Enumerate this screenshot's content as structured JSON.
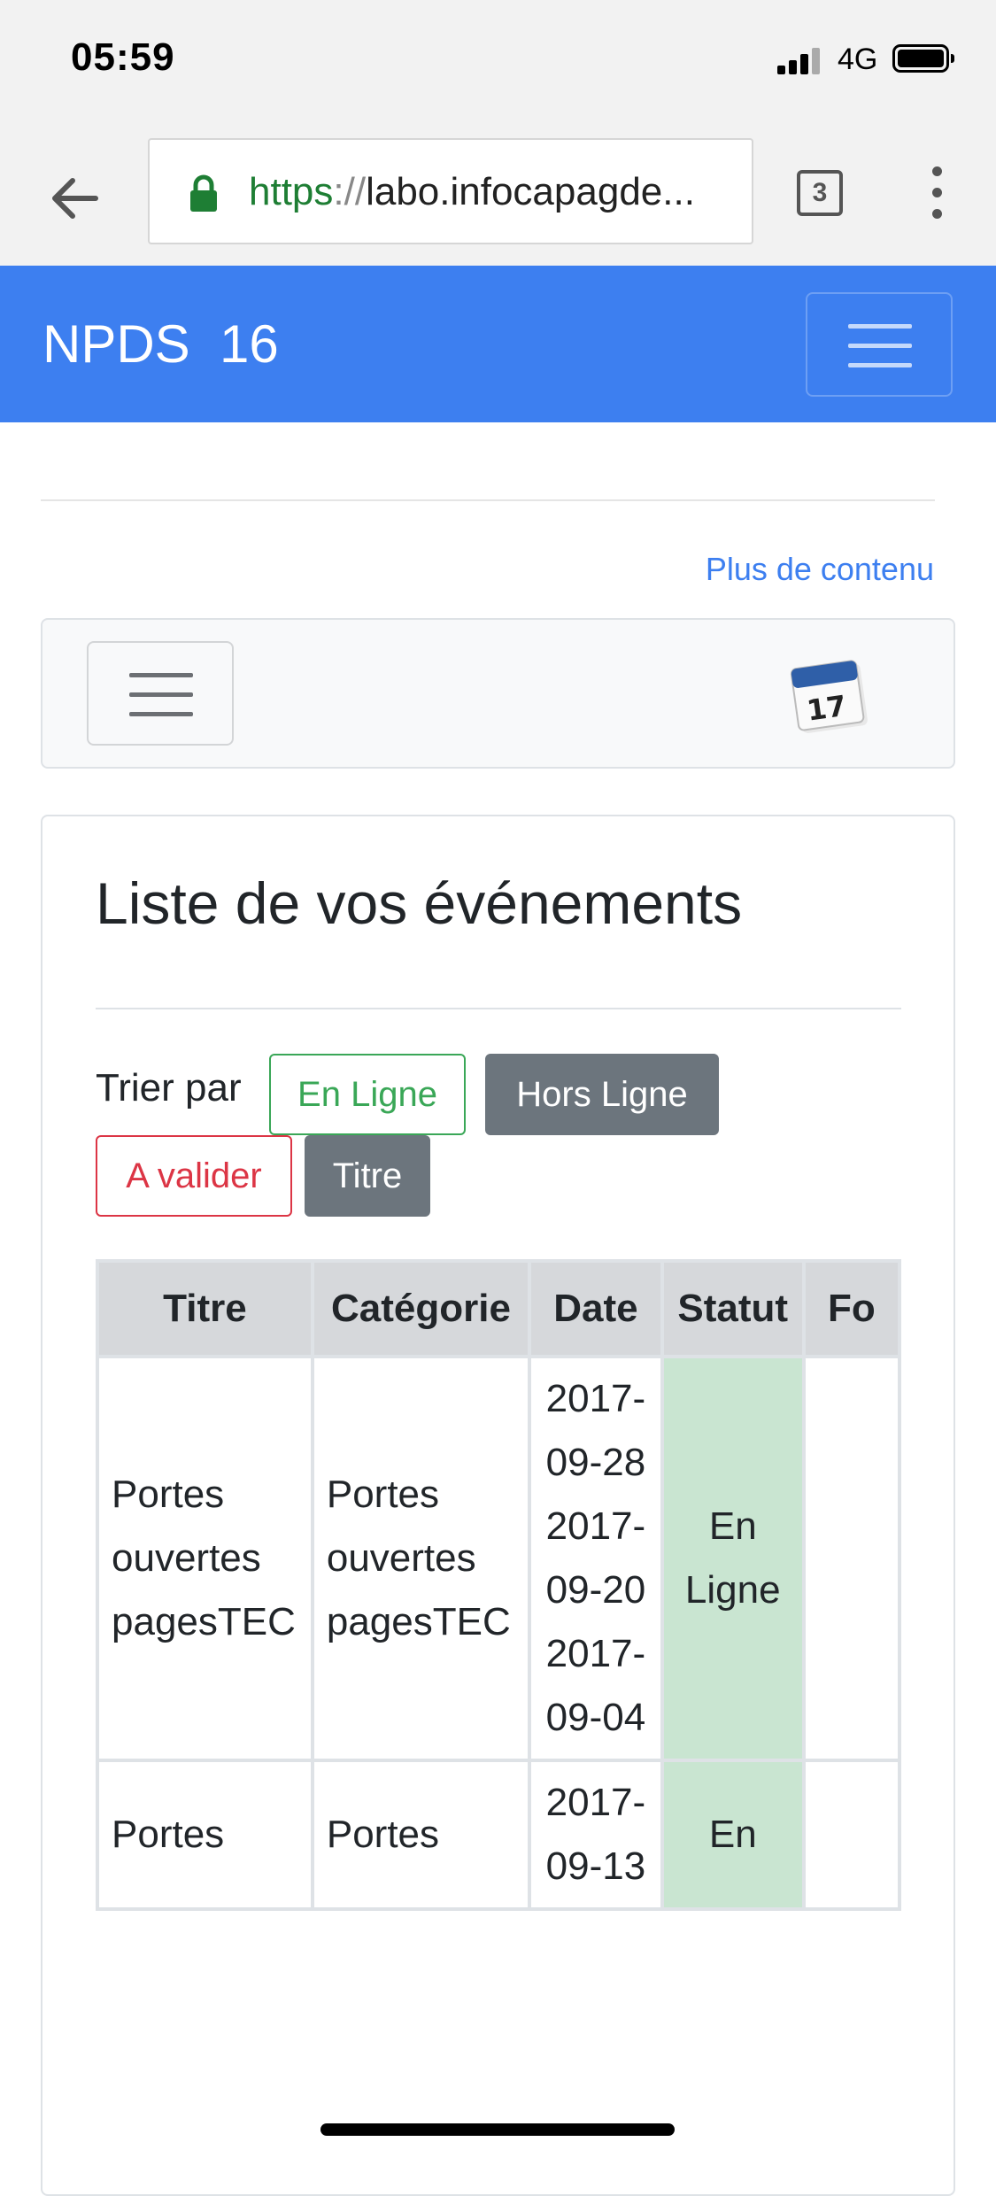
{
  "status_bar": {
    "time": "05:59",
    "network": "4G"
  },
  "browser": {
    "url_scheme": "https",
    "url_separator": "://",
    "url_host": "labo.infocapagde...",
    "tab_count": "3"
  },
  "navbar": {
    "brand": "NPDS  16"
  },
  "more_link": "Plus de contenu",
  "card": {
    "title": "Liste de vos événements",
    "sort_label": "Trier par",
    "buttons": {
      "online": "En Ligne",
      "offline": "Hors Ligne",
      "to_validate": "A valider",
      "title": "Titre"
    }
  },
  "table": {
    "headers": [
      "Titre",
      "Catégorie",
      "Date",
      "Statut",
      "Fo"
    ],
    "rows": [
      {
        "titre": "Portes ouvertes pagesTEC",
        "categorie": "Portes ouvertes pagesTEC",
        "dates": [
          "2017-09-28",
          "2017-09-20",
          "2017-09-04"
        ],
        "statut": "En Ligne",
        "fo": ""
      },
      {
        "titre": "Portes",
        "categorie": "Portes",
        "dates": [
          "2017-09-13"
        ],
        "statut": "En",
        "fo": ""
      }
    ]
  },
  "colors": {
    "navbar": "#3d7ff0",
    "online": "#3aa757",
    "validate": "#dc3545",
    "secondary": "#6c757d",
    "status_online_bg": "#c9e5d1"
  },
  "icons": [
    "back-arrow-icon",
    "lock-icon",
    "tabs-icon",
    "kebab-menu-icon",
    "hamburger-icon",
    "calendar-icon"
  ]
}
